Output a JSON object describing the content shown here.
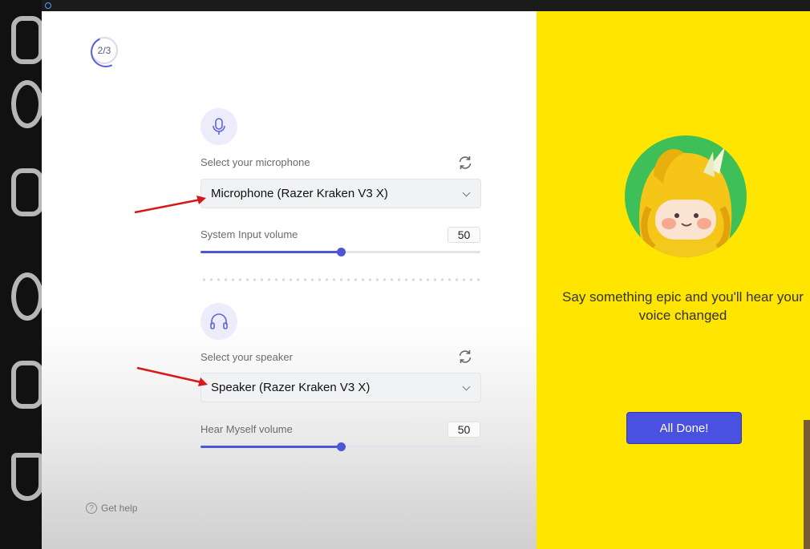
{
  "step": {
    "label": "2/3"
  },
  "microphone": {
    "select_label": "Select your microphone",
    "selected": "Microphone (Razer Kraken V3 X)",
    "volume_label": "System Input volume",
    "volume_value": "50",
    "volume_fraction": 0.5
  },
  "speaker": {
    "select_label": "Select your speaker",
    "selected": "Speaker (Razer Kraken V3 X)",
    "volume_label": "Hear Myself volume",
    "volume_value": "50",
    "volume_fraction": 0.5
  },
  "help": {
    "label": "Get help"
  },
  "right": {
    "message": "Say something epic and you'll hear your voice changed",
    "done_button": "All Done!"
  },
  "colors": {
    "accent": "#4e55d8",
    "panel_yellow": "#ffe500",
    "avatar_bg": "#3fbf57"
  },
  "icons": [
    "microphone-icon",
    "headphones-icon",
    "refresh-icon",
    "chevron-down-icon",
    "help-icon"
  ]
}
